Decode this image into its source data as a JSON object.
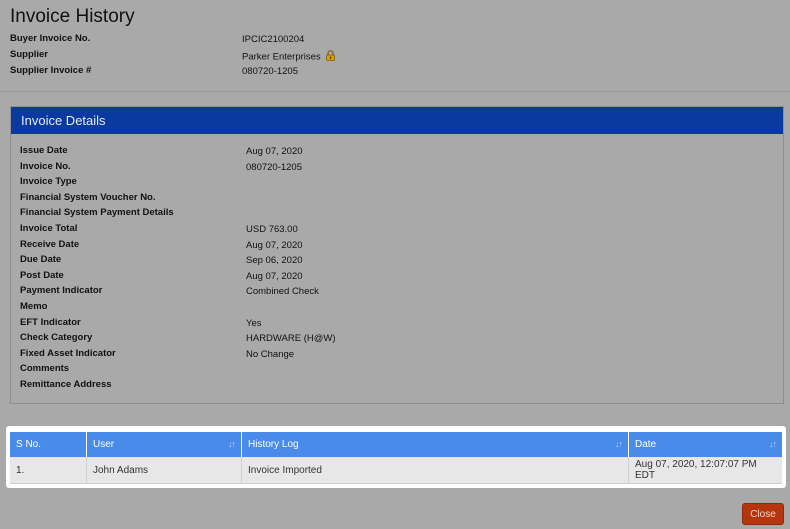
{
  "page_title": "Invoice History",
  "header_fields": [
    {
      "label": "Buyer Invoice No.",
      "value": "IPCIC2100204"
    },
    {
      "label": "Supplier",
      "value": "Parker Enterprises"
    },
    {
      "label": "Supplier Invoice #",
      "value": "080720-1205"
    }
  ],
  "details": {
    "title": "Invoice Details",
    "rows": [
      {
        "label": "Issue Date",
        "value": "Aug 07, 2020"
      },
      {
        "label": "Invoice No.",
        "value": "080720-1205"
      },
      {
        "label": "Invoice Type",
        "value": ""
      },
      {
        "label": "Financial System Voucher No.",
        "value": ""
      },
      {
        "label": "Financial System Payment Details",
        "value": ""
      },
      {
        "label": "Invoice Total",
        "value": "USD 763.00"
      },
      {
        "label": "Receive Date",
        "value": "Aug 07, 2020"
      },
      {
        "label": "Due Date",
        "value": "Sep 06, 2020"
      },
      {
        "label": "Post Date",
        "value": "Aug 07, 2020"
      },
      {
        "label": "Payment Indicator",
        "value": "Combined Check"
      },
      {
        "label": "Memo",
        "value": ""
      },
      {
        "label": "EFT Indicator",
        "value": "Yes"
      },
      {
        "label": "Check Category",
        "value": "HARDWARE (H@W)"
      },
      {
        "label": "Fixed Asset Indicator",
        "value": "No Change"
      },
      {
        "label": "Comments",
        "value": ""
      },
      {
        "label": "Remittance Address",
        "value": ""
      }
    ]
  },
  "history": {
    "columns": [
      "S No.",
      "User",
      "History Log",
      "Date"
    ],
    "rows": [
      {
        "sno": "1.",
        "user": "John Adams",
        "log": "Invoice Imported",
        "date": "Aug 07, 2020, 12:07:07 PM EDT"
      }
    ]
  },
  "close_label": "Close",
  "colors": {
    "panel_header": "#0a3aa0",
    "table_header": "#4a8bea",
    "close_button": "#b5360e"
  },
  "icons": {
    "supplier_icon": "lock-icon",
    "sort_icon": "sort-icon"
  }
}
